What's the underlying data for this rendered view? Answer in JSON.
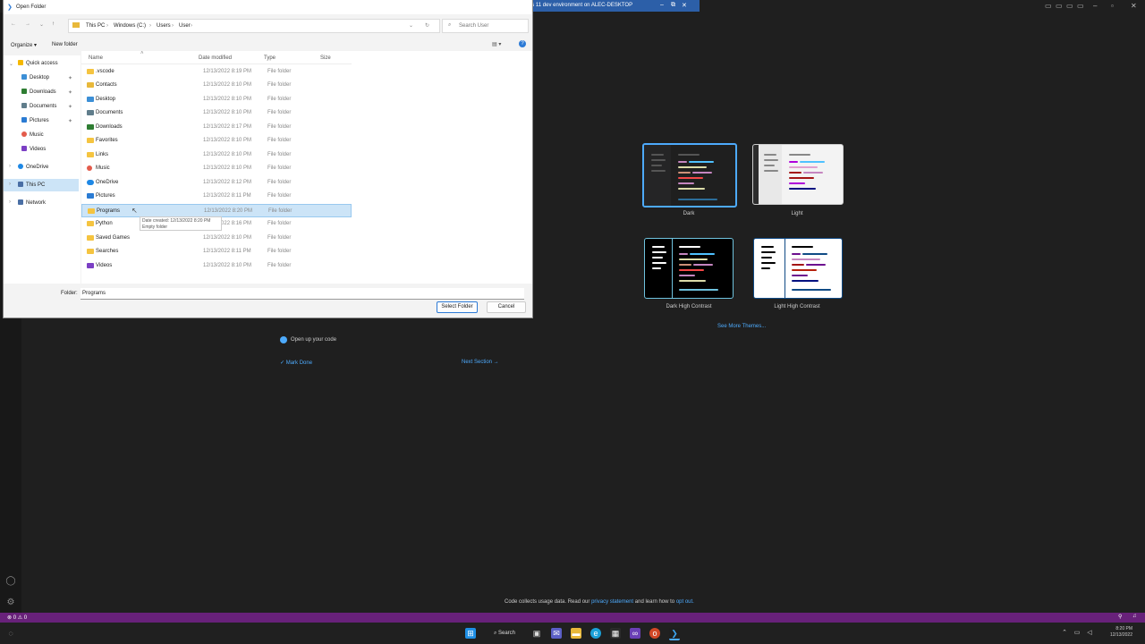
{
  "remote_bar": {
    "title": "Windows 11 dev environment on ALEC-DESKTOP"
  },
  "dialog": {
    "title": "Open Folder",
    "breadcrumb": [
      "This PC",
      "Windows (C:)",
      "Users",
      "User"
    ],
    "search_placeholder": "Search User",
    "organize_label": "Organize ▾",
    "new_folder_label": "New folder",
    "columns": {
      "name": "Name",
      "date": "Date modified",
      "type": "Type",
      "size": "Size"
    },
    "nav": [
      {
        "label": "Quick access",
        "color": "#f5b800"
      },
      {
        "label": "Desktop",
        "color": "#3c8fd6"
      },
      {
        "label": "Downloads",
        "color": "#2e7d32"
      },
      {
        "label": "Documents",
        "color": "#607d8b"
      },
      {
        "label": "Pictures",
        "color": "#2a7bd3"
      },
      {
        "label": "Music",
        "color": "#e35b4b"
      },
      {
        "label": "Videos",
        "color": "#7b3fc4"
      },
      {
        "label": "OneDrive",
        "color": "#1e88e5"
      },
      {
        "label": "This PC",
        "color": "#4a6fa5"
      },
      {
        "label": "Network",
        "color": "#4a6fa5"
      }
    ],
    "files": [
      {
        "name": ".vscode",
        "date": "12/13/2022 8:19 PM",
        "type": "File folder"
      },
      {
        "name": "Contacts",
        "date": "12/13/2022 8:10 PM",
        "type": "File folder"
      },
      {
        "name": "Desktop",
        "date": "12/13/2022 8:10 PM",
        "type": "File folder"
      },
      {
        "name": "Documents",
        "date": "12/13/2022 8:10 PM",
        "type": "File folder"
      },
      {
        "name": "Downloads",
        "date": "12/13/2022 8:17 PM",
        "type": "File folder"
      },
      {
        "name": "Favorites",
        "date": "12/13/2022 8:10 PM",
        "type": "File folder"
      },
      {
        "name": "Links",
        "date": "12/13/2022 8:10 PM",
        "type": "File folder"
      },
      {
        "name": "Music",
        "date": "12/13/2022 8:10 PM",
        "type": "File folder"
      },
      {
        "name": "OneDrive",
        "date": "12/13/2022 8:12 PM",
        "type": "File folder"
      },
      {
        "name": "Pictures",
        "date": "12/13/2022 8:11 PM",
        "type": "File folder"
      },
      {
        "name": "Programs",
        "date": "12/13/2022 8:20 PM",
        "type": "File folder"
      },
      {
        "name": "Python",
        "date": "12/13/2022 8:16 PM",
        "type": "File folder"
      },
      {
        "name": "Saved Games",
        "date": "12/13/2022 8:10 PM",
        "type": "File folder"
      },
      {
        "name": "Searches",
        "date": "12/13/2022 8:11 PM",
        "type": "File folder"
      },
      {
        "name": "Videos",
        "date": "12/13/2022 8:10 PM",
        "type": "File folder"
      }
    ],
    "tooltip": {
      "line1": "Date created: 12/13/2022 8:20 PM",
      "line2": "Empty folder"
    },
    "folder_label": "Folder:",
    "folder_value": "Programs",
    "select_button": "Select Folder",
    "cancel_button": "Cancel"
  },
  "themes": [
    {
      "label": "Dark"
    },
    {
      "label": "Light"
    },
    {
      "label": "Dark High Contrast"
    },
    {
      "label": "Light High Contrast"
    }
  ],
  "see_more": "See More Themes...",
  "walkthrough": {
    "step": "Open up your code",
    "mark_done": "Mark Done",
    "next_section": "Next Section →"
  },
  "telemetry": {
    "before": "Code collects usage data. Read our",
    "privacy": "privacy statement",
    "middle": "and learn how to",
    "optout": "opt out."
  },
  "statusbar": {
    "problems": "⊗ 0 ⚠ 0"
  },
  "taskbar": {
    "search_label": "Search",
    "time": "8:20 PM",
    "date": "12/13/2022"
  }
}
